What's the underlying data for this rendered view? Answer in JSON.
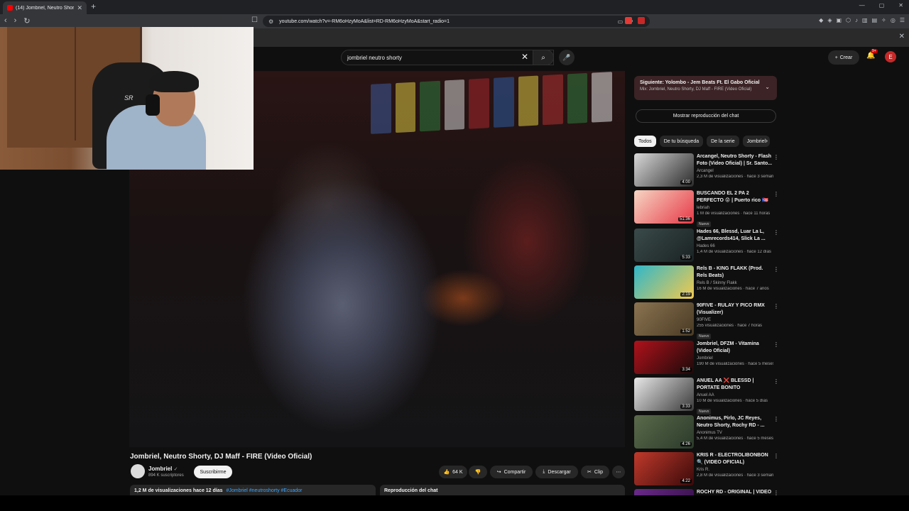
{
  "browser": {
    "tab_title": "(14) Jombriel, Neutro Shorty,",
    "url": "youtube.com/watch?v=-RM6oHzyMoA&list=RD-RM6oHzyMoA&start_radio=1"
  },
  "masthead": {
    "search_query": "jombriel neutro shorty",
    "create_label": "Crear",
    "notif_count": "9+",
    "avatar_letter": "E"
  },
  "webcam": {
    "chair_logo": "SR"
  },
  "video": {
    "title": "Jombriel, Neutro Shorty, DJ Maff - FIRE (Video Oficial)",
    "channel": "Jombriel",
    "subscribers": "894 K suscriptores",
    "subscribe_label": "Suscribirme",
    "likes": "64 K",
    "share_label": "Compartir",
    "download_label": "Descargar",
    "clip_label": "Clip",
    "views": "1,2 M de visualizaciones",
    "age": "hace 12 días",
    "tags": "#Jombriel #neutroshorty #Ecuador",
    "chat_replay_label": "Reproducción del chat"
  },
  "up_next": {
    "line1": "Siguiente: Yolombo - Jem Beats Ft. El Gabo Oficial",
    "line2": "Mix: Jombriel, Neutro Shorty, DJ Maff - FIRE (Video Oficial)"
  },
  "chat_toggle_label": "Mostrar reproducción del chat",
  "chips": [
    "Todos",
    "De tu búsqueda",
    "De la serie",
    "Jombriel"
  ],
  "recommendations": [
    {
      "title": "Arcangel, Neutro Shorty - Flash Foto (Video Oficial) | Sr. Santo...",
      "channel": "Arcangel",
      "meta": "2,3 M de visualizaciones · hace 3 semanas",
      "duration": "4:00",
      "badge": "",
      "c1": "#d9d9d9",
      "c2": "#2b2b2b"
    },
    {
      "title": "BUSCANDO EL 2 PA 2 PERFECTO 😡 | Puerto rico 🇵🇷",
      "channel": "lebriah",
      "meta": "1 M de visualizaciones · hace 11 horas",
      "duration": "51:36",
      "badge": "Nuevo",
      "c1": "#f6d6c4",
      "c2": "#e63946"
    },
    {
      "title": "Hades 66, Blessd, Luar La L, @Lamrecords414, Slick La ...",
      "channel": "Hades 66",
      "meta": "1,4 M de visualizaciones · hace 12 días",
      "duration": "5:33",
      "badge": "",
      "c1": "#3a4a4a",
      "c2": "#1a2222"
    },
    {
      "title": "Rels B - KING FLAKK (Prod. Rels Beats)",
      "channel": "Rels B / Skinny Flakk",
      "meta": "16 M de visualizaciones · hace 7 años",
      "duration": "2:19",
      "badge": "",
      "c1": "#2fb8c9",
      "c2": "#f2c94c"
    },
    {
      "title": "90FIVE - RULAY Y PICO RMX (Visualizer)",
      "channel": "90FIVE",
      "meta": "255 visualizaciones · hace 7 horas",
      "duration": "1:52",
      "badge": "Nuevo",
      "c1": "#8a7350",
      "c2": "#4a3b25"
    },
    {
      "title": "Jombriel, DFZM - Vitamina (Video Oficial)",
      "channel": "Jombriel",
      "meta": "190 M de visualizaciones · hace 5 meses",
      "duration": "3:34",
      "badge": "",
      "c1": "#b0121b",
      "c2": "#1a0a0a"
    },
    {
      "title": "ANUEL AA ❌ BLESSD | PORTATE BONITO",
      "channel": "Anuel AA",
      "meta": "10 M de visualizaciones · hace 5 días",
      "duration": "3:33",
      "badge": "Nuevo",
      "c1": "#e8e8e8",
      "c2": "#3a3a3a"
    },
    {
      "title": "Anonimus, Pirlo, JC Reyes, Neutro Shorty, Rochy RD - ...",
      "channel": "Anonimus TV",
      "meta": "5,4 M de visualizaciones · hace 5 meses",
      "duration": "4:26",
      "badge": "",
      "c1": "#5a6a4a",
      "c2": "#2a3a2a"
    },
    {
      "title": "KRIS R - ELECTROLIBONBON 🔍 (VIDEO OFICIAL)",
      "channel": "Kris R.",
      "meta": "2,8 M de visualizaciones · hace 3 semanas",
      "duration": "4:22",
      "badge": "",
      "c1": "#c0392b",
      "c2": "#3a0a0a"
    },
    {
      "title": "ROCHY RD - ORIGINAL | VIDEO",
      "channel": "",
      "meta": "",
      "duration": "",
      "badge": "",
      "c1": "#6a2a8a",
      "c2": "#2a0a3a"
    }
  ]
}
